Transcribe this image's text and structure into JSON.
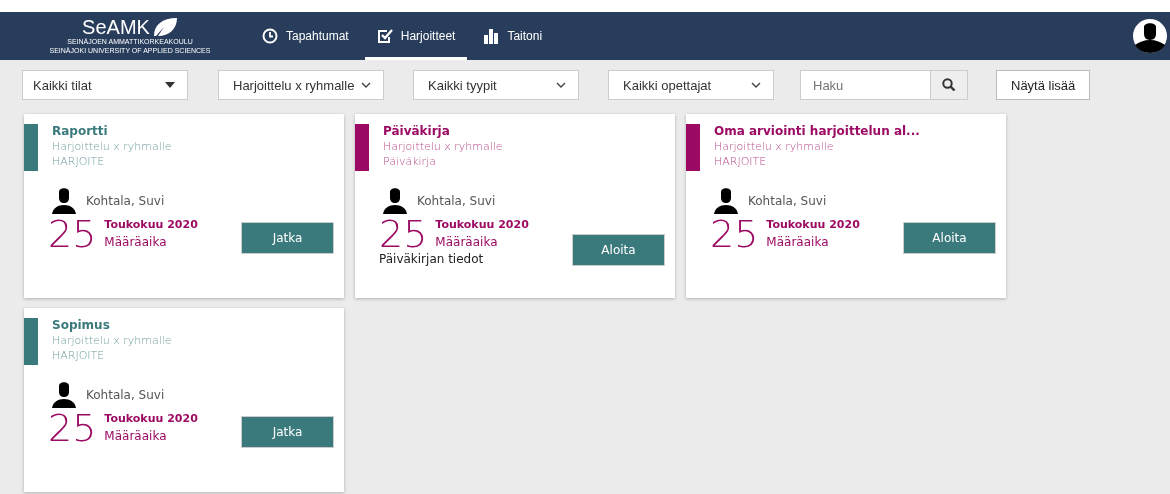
{
  "header": {
    "logo": {
      "name": "SeAMK",
      "line_1": "SEINÄJOEN AMMATTIKORKEAKOULU",
      "line_2": "SEINÄJOKI UNIVERSITY OF APPLIED SCIENCES"
    },
    "nav": [
      {
        "label": "Tapahtumat",
        "kind": "clock",
        "selected": false
      },
      {
        "label": "Harjoitteet",
        "kind": "check",
        "selected": true
      },
      {
        "label": "Taitoni",
        "kind": "bars",
        "selected": false
      }
    ]
  },
  "filters": {
    "selects": [
      {
        "value": "Kaikki tilat",
        "kind": "caret"
      },
      {
        "value": "Harjoittelu x ryhmalle",
        "kind": "chevron"
      },
      {
        "value": "Kaikki tyypit",
        "kind": "chevron"
      },
      {
        "value": "Kaikki opettajat",
        "kind": "chevron"
      }
    ],
    "search": {
      "placeholder": "Haku"
    },
    "more_button": "Näytä lisää"
  },
  "cards": [
    {
      "title": "Raportti",
      "subtitle": "Harjoittelu x ryhmalle",
      "type": "HARJOITE",
      "color": "#3a7a7c",
      "teacher": "Kohtala, Suvi",
      "day": "25",
      "month": "Toukokuu 2020",
      "deadline": "Määräaika",
      "button": "Jatka"
    },
    {
      "title": "Päiväkirja",
      "subtitle": "Harjoittelu x ryhmalle",
      "type": "Päiväkirja",
      "color": "#9c0b63",
      "teacher": "Kohtala, Suvi",
      "day": "25",
      "month": "Toukokuu 2020",
      "deadline": "Määräaika",
      "info": "Päiväkirjan tiedot",
      "button": "Aloita"
    },
    {
      "title": "Oma arviointi harjoittelun al...",
      "subtitle": "Harjoittelu x ryhmalle",
      "type": "HARJOITE",
      "color": "#9c0b63",
      "teacher": "Kohtala, Suvi",
      "day": "25",
      "month": "Toukokuu 2020",
      "deadline": "Määräaika",
      "button": "Aloita"
    },
    {
      "title": "Sopimus",
      "subtitle": "Harjoittelu x ryhmalle",
      "type": "HARJOITE",
      "color": "#3a7a7c",
      "teacher": "Kohtala, Suvi",
      "day": "25",
      "month": "Toukokuu 2020",
      "deadline": "Määräaika",
      "button": "Jatka"
    }
  ]
}
